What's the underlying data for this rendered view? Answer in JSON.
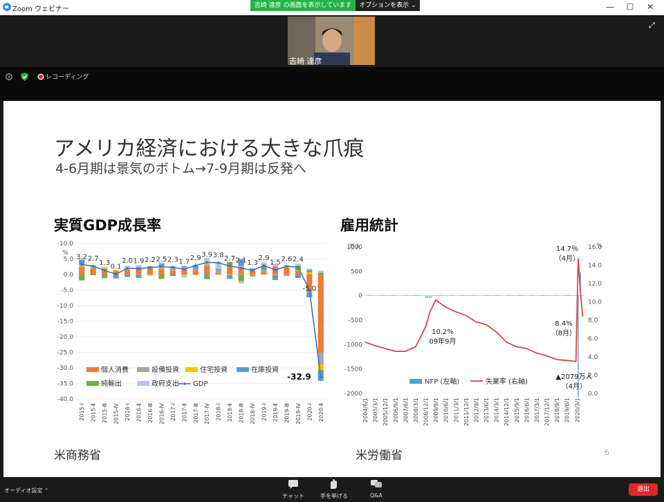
{
  "window": {
    "title": "Zoom ウェビナー",
    "share_banner": "吉崎 達彦 の画面を表示しています",
    "options_label": "オプションを表示",
    "min_icon": "minimize-icon",
    "max_icon": "maximize-icon",
    "close_icon": "close-icon"
  },
  "video": {
    "participant_name": "吉崎 達彦"
  },
  "status": {
    "recording_label": "レコーディング"
  },
  "slide": {
    "title": "アメリカ経済における大きな爪痕",
    "subtitle": "4-6月期は景気のボトム→7-9月期は反発へ",
    "gdp_heading": "実質GDP成長率",
    "emp_heading": "雇用統計",
    "source_left": "米商務省",
    "source_right": "米労働省",
    "page_number": "6"
  },
  "toolbar": {
    "audio_settings": "オーディオ設定",
    "chat": "チャット",
    "raise_hand": "手を挙げる",
    "qa": "Q&A",
    "leave": "退出"
  },
  "colors": {
    "consumption": "#ed7d31",
    "investment": "#a5a5a5",
    "housing": "#ffc000",
    "inventory": "#5b9bd5",
    "net_exports": "#70ad47",
    "government": "#b4c7e7",
    "gdp_line": "#4472c4",
    "nfp": "#5b9bd5",
    "unemployment": "#d9434b"
  },
  "chart_data": [
    {
      "type": "bar",
      "stacked": true,
      "ylabel": "%",
      "ylim": [
        -40,
        10
      ],
      "yticks": [
        "10.0",
        "5.0",
        "0.0",
        "-5.0",
        "-10.0",
        "-15.0",
        "-20.0",
        "-25.0",
        "-30.0",
        "-35.0",
        "-40.0"
      ],
      "categories": [
        "2015-Ⅰ",
        "2015-Ⅱ",
        "2015-Ⅲ",
        "2015-Ⅳ",
        "2016-Ⅰ",
        "2016-Ⅱ",
        "2016-Ⅲ",
        "2016-Ⅳ",
        "2017-Ⅰ",
        "2017-Ⅱ",
        "2017-Ⅲ",
        "2017-Ⅳ",
        "2018-Ⅰ",
        "2018-Ⅱ",
        "2018-Ⅲ",
        "2018-Ⅳ",
        "2019-Ⅰ",
        "2019-Ⅱ",
        "2019-Ⅲ",
        "2019-Ⅳ",
        "2020-Ⅰ",
        "2020-Ⅱ"
      ],
      "gdp_labels": [
        "3.2",
        "2.7",
        "1.3",
        "0.1",
        "2.0",
        "1.9",
        "2.2",
        "2.5",
        "2.3",
        "1.7",
        "2.9",
        "3.9",
        "3.8",
        "2.7",
        "2.1",
        "1.3",
        "2.9",
        "1.5",
        "2.6",
        "2.4",
        "-5.0",
        "-32.9"
      ],
      "gdp": [
        3.2,
        2.7,
        1.3,
        0.1,
        2.0,
        1.9,
        2.2,
        2.5,
        2.3,
        1.7,
        2.9,
        3.9,
        3.8,
        2.7,
        2.1,
        1.3,
        2.9,
        1.5,
        2.6,
        2.4,
        -5.0,
        -32.9
      ],
      "series": [
        {
          "name": "個人消費",
          "key": "consumption",
          "values": [
            2.4,
            2.0,
            1.8,
            1.2,
            1.5,
            2.0,
            1.8,
            1.6,
            1.3,
            2.0,
            1.5,
            2.7,
            0.5,
            2.3,
            2.4,
            1.0,
            0.8,
            2.5,
            2.1,
            1.1,
            -4.8,
            -25.0
          ]
        },
        {
          "name": "設備投資",
          "key": "investment",
          "values": [
            0.3,
            0.2,
            0.1,
            -0.1,
            0.0,
            0.2,
            0.3,
            0.4,
            0.6,
            0.4,
            0.4,
            0.6,
            0.8,
            0.6,
            0.3,
            0.5,
            0.6,
            -0.1,
            -0.3,
            -0.1,
            -1.1,
            -3.9
          ]
        },
        {
          "name": "住宅投資",
          "key": "housing",
          "values": [
            0.4,
            0.3,
            0.4,
            0.3,
            0.4,
            -0.1,
            -0.2,
            0.3,
            0.3,
            -0.3,
            -0.2,
            0.5,
            -0.1,
            -0.2,
            -0.1,
            -0.2,
            0.0,
            -0.1,
            0.2,
            0.2,
            0.7,
            -1.8
          ]
        },
        {
          "name": "在庫投資",
          "key": "inventory",
          "values": [
            1.6,
            0.4,
            -0.6,
            -0.6,
            -0.8,
            -1.0,
            0.2,
            1.2,
            -0.5,
            0.3,
            0.8,
            -0.6,
            0.4,
            -1.2,
            2.3,
            0.5,
            0.5,
            -0.9,
            -0.1,
            -1.0,
            -1.4,
            -3.5
          ]
        },
        {
          "name": "純輸出",
          "key": "net_exports",
          "values": [
            -1.9,
            -0.2,
            -0.6,
            -0.5,
            0.0,
            0.2,
            0.4,
            -1.4,
            0.0,
            0.0,
            0.3,
            -0.9,
            0.0,
            1.1,
            -2.0,
            -0.4,
            0.7,
            -0.7,
            -0.1,
            1.5,
            0.8,
            0.6
          ]
        },
        {
          "name": "政府支出",
          "key": "government",
          "values": [
            0.4,
            0.0,
            0.2,
            -0.2,
            0.9,
            0.6,
            -0.3,
            0.4,
            0.6,
            -0.7,
            0.1,
            1.6,
            2.2,
            0.1,
            -0.8,
            -0.1,
            1.3,
            0.8,
            0.8,
            0.7,
            0.4,
            0.7
          ]
        }
      ],
      "legend": [
        "個人消費",
        "設備投資",
        "住宅投資",
        "在庫投資",
        "純輸出",
        "政府支出",
        "GDP"
      ],
      "annotations": [
        "-32.9",
        "-5.0"
      ]
    },
    {
      "type": "line",
      "y_left": {
        "label": "万人",
        "ylim": [
          -2000,
          1000
        ],
        "ticks": [
          "1000",
          "500",
          "0",
          "-500",
          "-1000",
          "-1500",
          "-2000"
        ]
      },
      "y_right": {
        "label": "%",
        "ylim": [
          0,
          16
        ],
        "ticks": [
          "16.0",
          "14.0",
          "12.0",
          "10.0",
          "8.0",
          "6.0",
          "4.0",
          "2.0",
          "0.0"
        ]
      },
      "x_ticks": [
        "2004/6/1",
        "2005/3/1",
        "2005/12/1",
        "2006/9/1",
        "2007/6/1",
        "2008/3/1",
        "2008/12/1",
        "2009/9/1",
        "2010/6/1",
        "2011/3/1",
        "2011/12/1",
        "2012/9/1",
        "2013/6/1",
        "2014/3/1",
        "2014/12/1",
        "2015/9/1",
        "2016/6/1",
        "2017/3/1",
        "2017/12/1",
        "2018/9/1",
        "2019/6/1",
        "2020/3/1"
      ],
      "series": [
        {
          "name": "NFP (左軸)",
          "axis": "left",
          "type": "bar"
        },
        {
          "name": "失業率 (右軸)",
          "axis": "right",
          "type": "line",
          "x": [
            "2004/6/1",
            "2005/3/1",
            "2005/12/1",
            "2006/9/1",
            "2007/6/1",
            "2008/3/1",
            "2008/12/1",
            "2009/4/1",
            "2009/9/1",
            "2010/6/1",
            "2011/3/1",
            "2011/12/1",
            "2012/9/1",
            "2013/6/1",
            "2014/3/1",
            "2014/12/1",
            "2015/9/1",
            "2016/6/1",
            "2017/3/1",
            "2017/12/1",
            "2018/9/1",
            "2019/6/1",
            "2020/2/1",
            "2020/4/1",
            "2020/6/1",
            "2020/8/1"
          ],
          "values": [
            5.6,
            5.2,
            4.9,
            4.6,
            4.6,
            5.1,
            7.3,
            9.0,
            10.2,
            9.4,
            8.9,
            8.5,
            7.8,
            7.5,
            6.7,
            5.6,
            5.1,
            4.9,
            4.4,
            4.1,
            3.7,
            3.6,
            3.5,
            14.7,
            11.1,
            8.4
          ]
        }
      ],
      "annotations": [
        {
          "text": "14.7％",
          "sub": "（4月）"
        },
        {
          "text": "10.2%",
          "sub": "09年9月"
        },
        {
          "text": "8.4%",
          "sub": "（8月）"
        },
        {
          "text": "▲2079万人",
          "sub": "（4月）"
        }
      ]
    }
  ]
}
